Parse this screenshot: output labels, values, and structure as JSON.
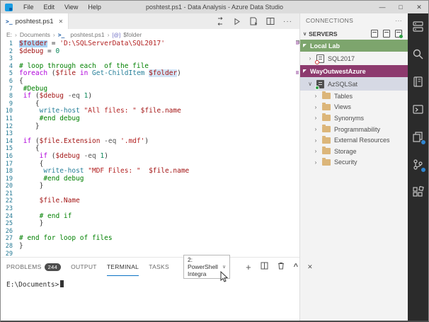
{
  "window": {
    "title": "poshtest.ps1 - Data Analysis - Azure Data Studio",
    "menus": [
      "File",
      "Edit",
      "View",
      "Help"
    ],
    "controls": {
      "minimize": "—",
      "maximize": "□",
      "close": "✕"
    }
  },
  "tab": {
    "label": "poshtest.ps1",
    "close": "✕",
    "ps_glyph": ">_"
  },
  "breadcrumb": {
    "items": [
      "E:",
      "Documents",
      "poshtest.ps1",
      "$folder"
    ],
    "separator": "›",
    "symbol": "[@]"
  },
  "editor": {
    "lines": [
      [
        [
          "var",
          "$folder",
          "hl1"
        ],
        [
          "plain",
          " = "
        ],
        [
          "str",
          "'D:\\SQLServerData\\SQL2017'"
        ]
      ],
      [
        [
          "var",
          "$debug"
        ],
        [
          "plain",
          " = "
        ],
        [
          "num",
          "0"
        ]
      ],
      [],
      [
        [
          "com",
          "# loop through each  of the file"
        ]
      ],
      [
        [
          "kw",
          "foreach"
        ],
        [
          "plain",
          " ("
        ],
        [
          "var",
          "$file"
        ],
        [
          "plain",
          " "
        ],
        [
          "kw",
          "in"
        ],
        [
          "plain",
          " "
        ],
        [
          "cmd",
          "Get-ChildItem"
        ],
        [
          "plain",
          " "
        ],
        [
          "var",
          "$folder",
          "hl2"
        ],
        [
          "plain",
          ")"
        ]
      ],
      [
        [
          "plain",
          "{"
        ]
      ],
      [
        [
          "plain",
          " "
        ],
        [
          "com",
          "#Debug"
        ]
      ],
      [
        [
          "plain",
          " "
        ],
        [
          "kw",
          "if"
        ],
        [
          "plain",
          " ("
        ],
        [
          "var",
          "$debug"
        ],
        [
          "plain",
          " "
        ],
        [
          "op",
          "-eq"
        ],
        [
          "plain",
          " "
        ],
        [
          "num",
          "1"
        ],
        [
          "plain",
          ")"
        ]
      ],
      [
        [
          "plain",
          "    {"
        ]
      ],
      [
        [
          "plain",
          "     "
        ],
        [
          "cmd",
          "write-host"
        ],
        [
          "plain",
          " "
        ],
        [
          "str",
          "\"All files: \""
        ],
        [
          "plain",
          " "
        ],
        [
          "var",
          "$file.name"
        ]
      ],
      [
        [
          "plain",
          "     "
        ],
        [
          "com",
          "#end debug"
        ]
      ],
      [
        [
          "plain",
          "    }"
        ]
      ],
      [],
      [
        [
          "plain",
          " "
        ],
        [
          "kw",
          "if"
        ],
        [
          "plain",
          " ("
        ],
        [
          "var",
          "$file.Extension"
        ],
        [
          "plain",
          " "
        ],
        [
          "op",
          "-eq"
        ],
        [
          "plain",
          " "
        ],
        [
          "str",
          "'.mdf'"
        ],
        [
          "plain",
          ")"
        ]
      ],
      [
        [
          "plain",
          "    {"
        ]
      ],
      [
        [
          "plain",
          "     "
        ],
        [
          "kw",
          "if"
        ],
        [
          "plain",
          " ("
        ],
        [
          "var",
          "$debug"
        ],
        [
          "plain",
          " "
        ],
        [
          "op",
          "-eq"
        ],
        [
          "plain",
          " "
        ],
        [
          "num",
          "1"
        ],
        [
          "plain",
          ")"
        ]
      ],
      [
        [
          "plain",
          "     {"
        ]
      ],
      [
        [
          "plain",
          "      "
        ],
        [
          "cmd",
          "write-host"
        ],
        [
          "plain",
          " "
        ],
        [
          "str",
          "\"MDF Files: \""
        ],
        [
          "plain",
          "  "
        ],
        [
          "var",
          "$file.name"
        ]
      ],
      [
        [
          "plain",
          "      "
        ],
        [
          "com",
          "#end debug"
        ]
      ],
      [
        [
          "plain",
          "     }"
        ]
      ],
      [],
      [
        [
          "plain",
          "     "
        ],
        [
          "var",
          "$file.Name"
        ]
      ],
      [],
      [
        [
          "plain",
          "     "
        ],
        [
          "com",
          "# end if"
        ]
      ],
      [
        [
          "plain",
          "     }"
        ]
      ],
      [],
      [
        [
          "com",
          "# end for loop of files"
        ]
      ],
      [
        [
          "plain",
          "}"
        ]
      ],
      []
    ]
  },
  "panel": {
    "tabs": [
      {
        "label": "PROBLEMS",
        "badge": "244"
      },
      {
        "label": "OUTPUT"
      },
      {
        "label": "TERMINAL",
        "active": true
      },
      {
        "label": "TASKS"
      }
    ],
    "dropdown": "2: PowerShell Integra",
    "dropdown_caret": "∨",
    "terminal_prompt": "E:\\Documents>"
  },
  "sidebar": {
    "header": "CONNECTIONS",
    "more": "···",
    "section": "SERVERS",
    "section_chevron": "∨",
    "groups": [
      {
        "name": "Local Lab",
        "color": "#7da56d",
        "servers": [
          {
            "name": "SQL2017",
            "status": "disconnected",
            "expanded": false,
            "children": []
          }
        ]
      },
      {
        "name": "WayOutwestAzure",
        "color": "#8d3a6e",
        "servers": [
          {
            "name": "AzSQLSat",
            "status": "connected",
            "selected": true,
            "expanded": true,
            "children": [
              "Tables",
              "Views",
              "Synonyms",
              "Programmability",
              "External Resources",
              "Storage",
              "Security"
            ]
          }
        ]
      }
    ]
  },
  "activity_bar": {
    "icons": [
      {
        "name": "connections-icon"
      },
      {
        "name": "search-icon"
      },
      {
        "name": "notebook-icon"
      },
      {
        "name": "terminal-icon"
      },
      {
        "name": "copy-icon",
        "badge": true
      },
      {
        "name": "source-control-icon",
        "badge": true
      },
      {
        "name": "extensions-icon"
      }
    ]
  },
  "colors": {
    "accent": "#0b72c4",
    "group_green": "#7da56d",
    "group_plum": "#8d3a6e",
    "folder": "#dcb67a",
    "badge": "#4d4d4d",
    "word_highlight": "#a9d3f5",
    "status_connected": "#2ea043",
    "status_disconnected": "#d03535"
  }
}
